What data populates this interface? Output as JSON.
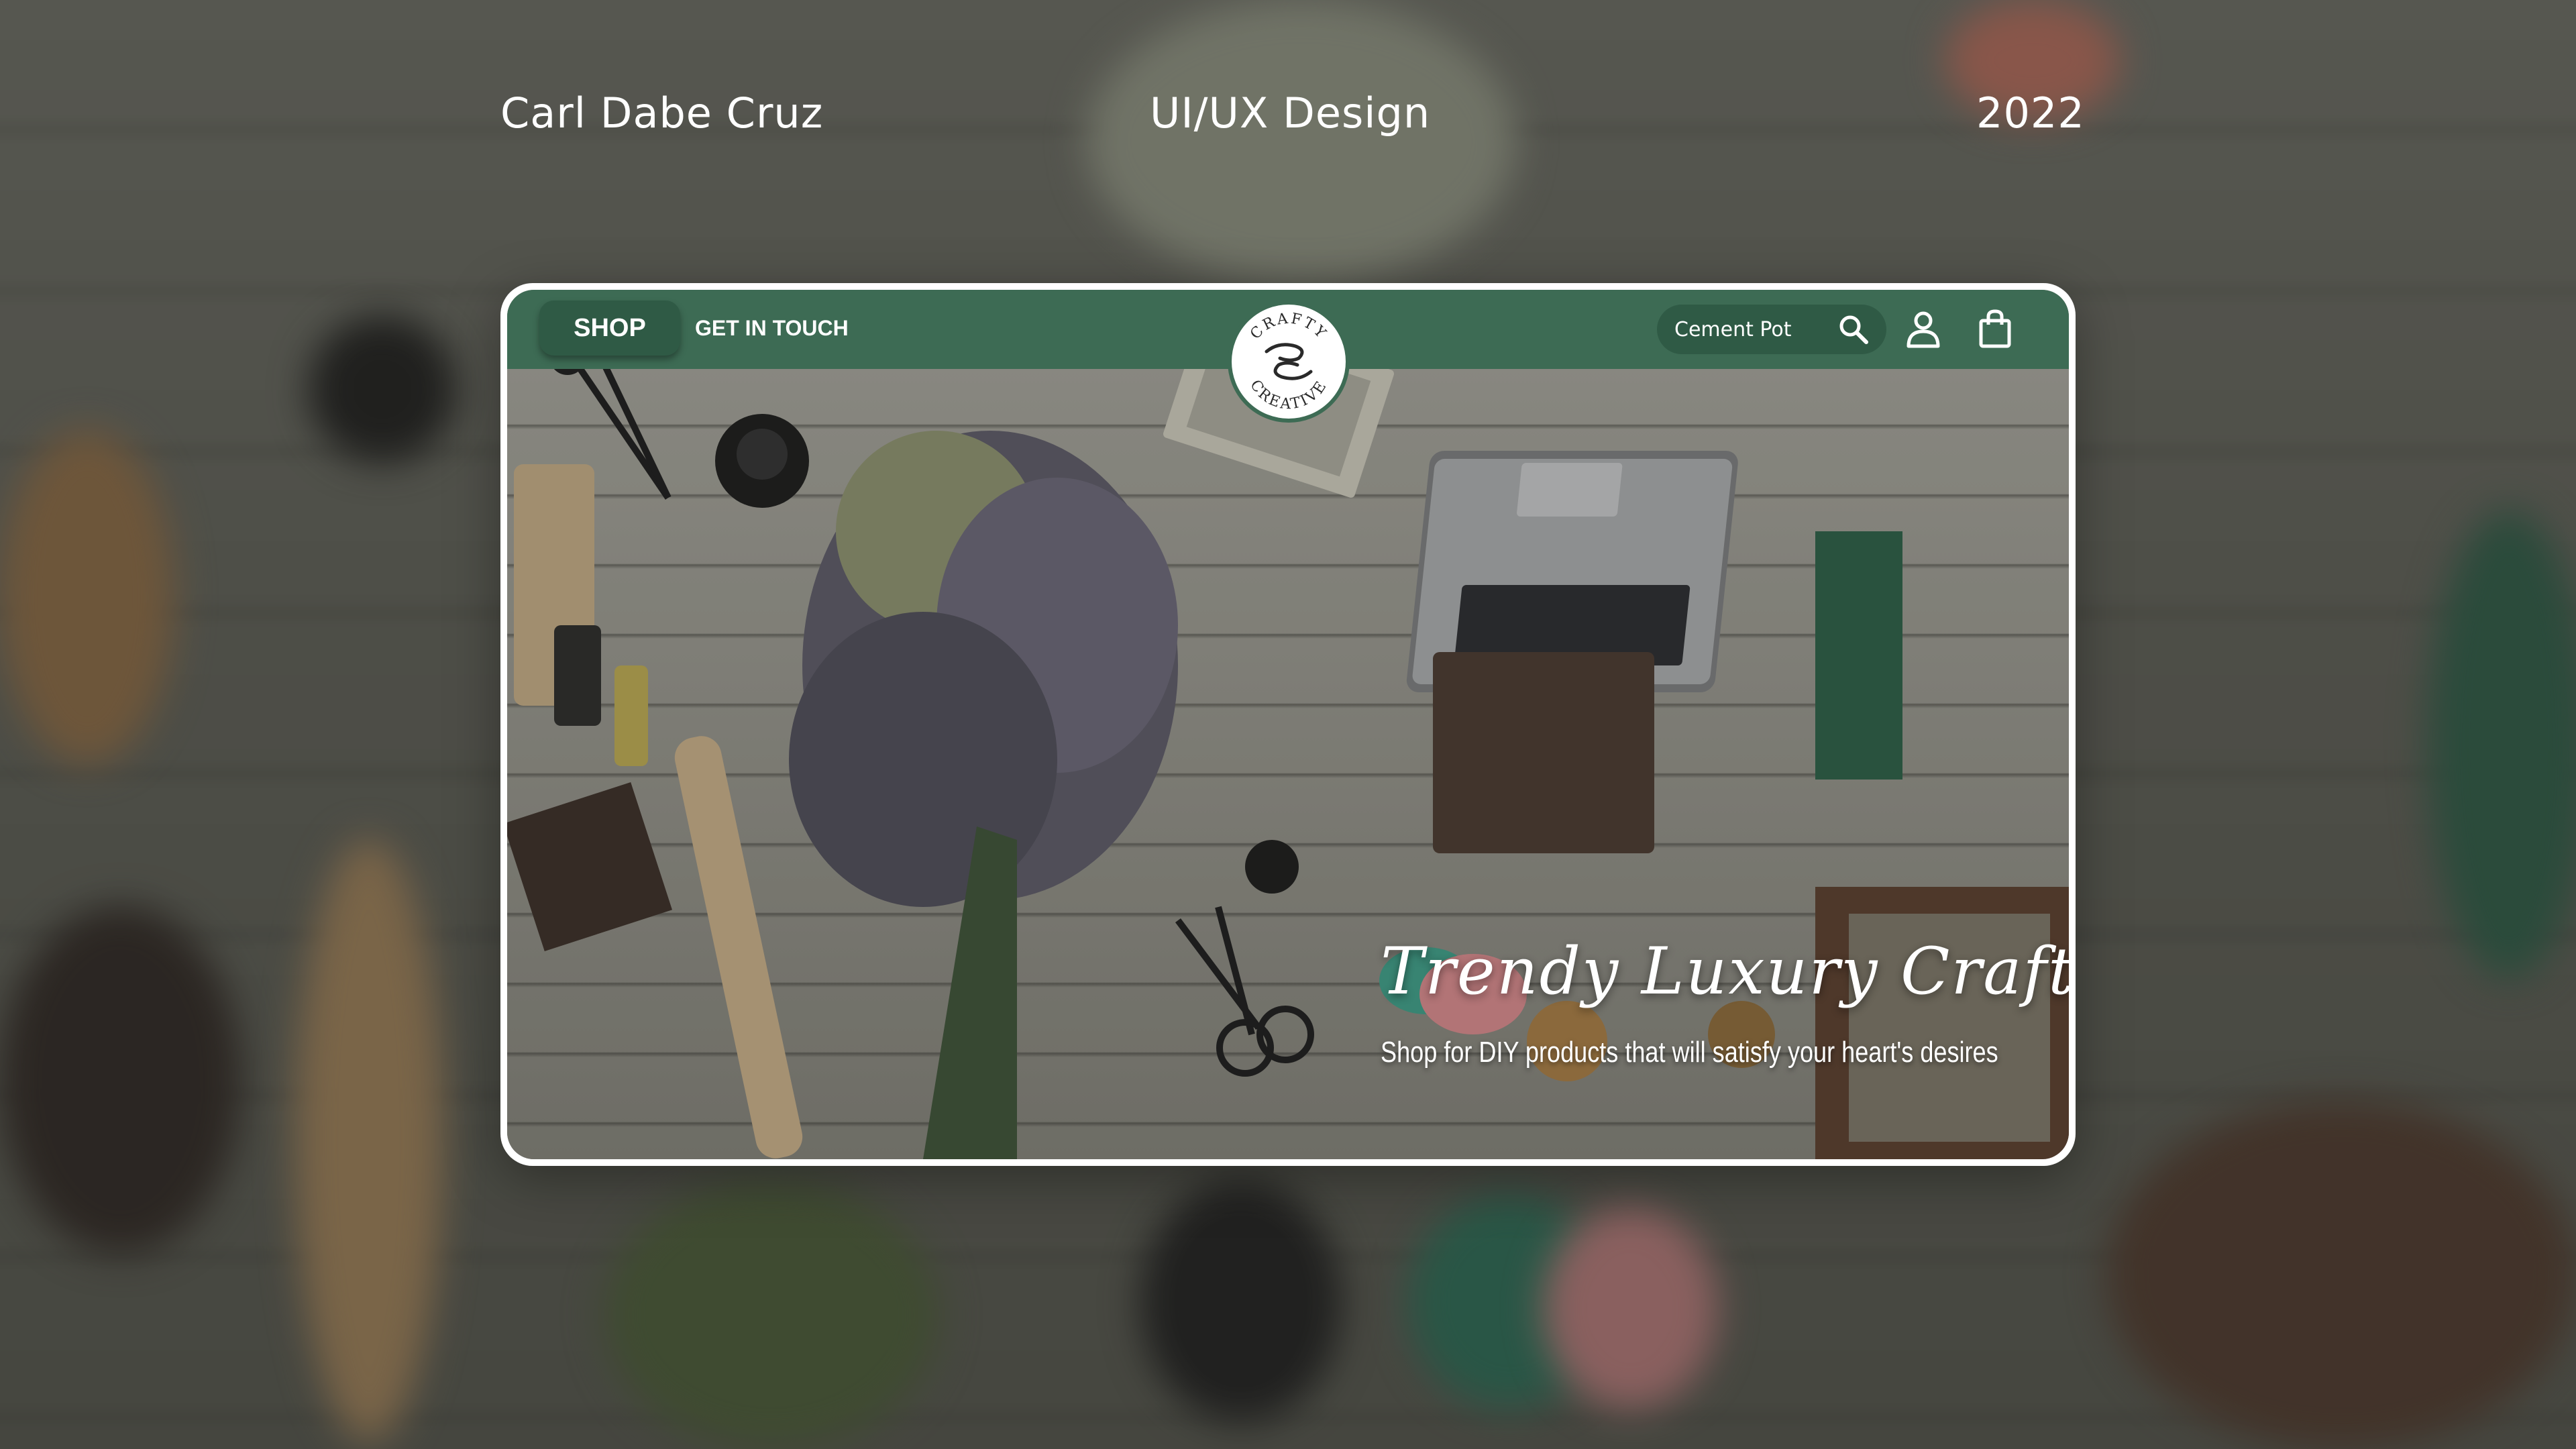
{
  "header": {
    "author": "Carl Dabe Cruz",
    "discipline": "UI/UX Design",
    "year": "2022"
  },
  "nav": {
    "shop_label": "SHOP",
    "contact_label": "GET IN TOUCH",
    "search_value": "Cement Pot"
  },
  "logo": {
    "text_top": "CRAFTY",
    "text_bottom": "CREATIVE"
  },
  "hero": {
    "title": "Trendy Luxury Crafts",
    "subtitle": "Shop for DIY products that will satisfy your heart's desires"
  },
  "colors": {
    "nav_green": "#3d6b54",
    "nav_dark_green": "#2f5a45",
    "frame": "#ffffff"
  },
  "icons": {
    "search": "search-icon",
    "account": "user-icon",
    "cart": "shopping-bag-icon"
  }
}
